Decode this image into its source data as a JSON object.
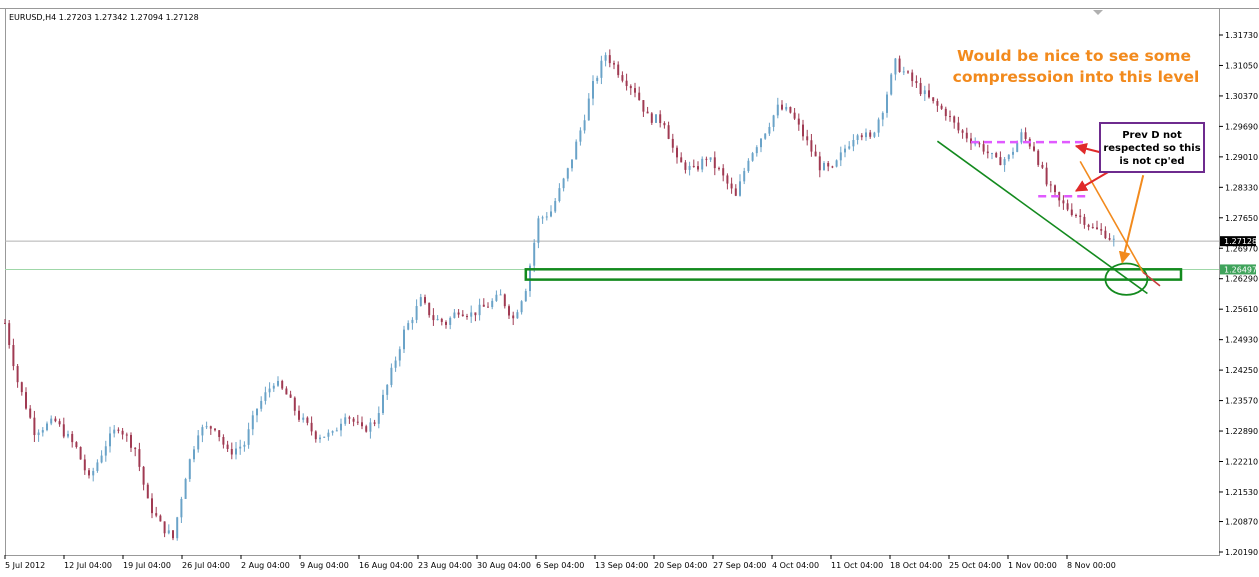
{
  "chart_data": {
    "type": "candlestick",
    "title": "EURUSD,H4  1.27203 1.27342 1.27094 1.27128",
    "symbol": "EURUSD",
    "timeframe": "H4",
    "ohlc_header": {
      "open": 1.27203,
      "high": 1.27342,
      "low": 1.27094,
      "close": 1.27128
    },
    "x_tick_labels": [
      "5 Jul 2012",
      "12 Jul 04:00",
      "19 Jul 04:00",
      "26 Jul 04:00",
      "2 Aug 04:00",
      "9 Aug 04:00",
      "16 Aug 04:00",
      "23 Aug 04:00",
      "30 Aug 04:00",
      "6 Sep 04:00",
      "13 Sep 04:00",
      "20 Sep 04:00",
      "27 Sep 04:00",
      "4 Oct 04:00",
      "11 Oct 04:00",
      "18 Oct 04:00",
      "25 Oct 04:00",
      "1 Nov 00:00",
      "8 Nov 00:00"
    ],
    "y_tick_labels": [
      "1.31730",
      "1.31050",
      "1.30370",
      "1.29690",
      "1.29010",
      "1.28330",
      "1.27650",
      "1.26970",
      "1.26290",
      "1.25610",
      "1.24930",
      "1.24250",
      "1.23570",
      "1.22890",
      "1.22210",
      "1.21530",
      "1.20870",
      "1.20190"
    ],
    "ylim": [
      1.2019,
      1.3173
    ],
    "bull_color": "#6aa3c8",
    "bear_color": "#a03a52",
    "price_path": [
      {
        "x": 0,
        "y": 1.253
      },
      {
        "x": 3,
        "y": 1.24
      },
      {
        "x": 7,
        "y": 1.229
      },
      {
        "x": 12,
        "y": 1.231
      },
      {
        "x": 17,
        "y": 1.225
      },
      {
        "x": 20,
        "y": 1.218
      },
      {
        "x": 24,
        "y": 1.226
      },
      {
        "x": 27,
        "y": 1.23
      },
      {
        "x": 31,
        "y": 1.225
      },
      {
        "x": 34,
        "y": 1.213
      },
      {
        "x": 37,
        "y": 1.208
      },
      {
        "x": 40,
        "y": 1.205
      },
      {
        "x": 43,
        "y": 1.219
      },
      {
        "x": 46,
        "y": 1.229
      },
      {
        "x": 50,
        "y": 1.23
      },
      {
        "x": 53,
        "y": 1.224
      },
      {
        "x": 57,
        "y": 1.226
      },
      {
        "x": 60,
        "y": 1.234
      },
      {
        "x": 64,
        "y": 1.24
      },
      {
        "x": 67,
        "y": 1.237
      },
      {
        "x": 70,
        "y": 1.232
      },
      {
        "x": 74,
        "y": 1.228
      },
      {
        "x": 78,
        "y": 1.228
      },
      {
        "x": 81,
        "y": 1.233
      },
      {
        "x": 85,
        "y": 1.229
      },
      {
        "x": 88,
        "y": 1.231
      },
      {
        "x": 91,
        "y": 1.239
      },
      {
        "x": 95,
        "y": 1.251
      },
      {
        "x": 99,
        "y": 1.258
      },
      {
        "x": 102,
        "y": 1.254
      },
      {
        "x": 105,
        "y": 1.253
      },
      {
        "x": 108,
        "y": 1.256
      },
      {
        "x": 111,
        "y": 1.255
      },
      {
        "x": 115,
        "y": 1.257
      },
      {
        "x": 118,
        "y": 1.259
      },
      {
        "x": 121,
        "y": 1.254
      },
      {
        "x": 124,
        "y": 1.261
      },
      {
        "x": 127,
        "y": 1.276
      },
      {
        "x": 130,
        "y": 1.278
      },
      {
        "x": 134,
        "y": 1.287
      },
      {
        "x": 137,
        "y": 1.296
      },
      {
        "x": 140,
        "y": 1.306
      },
      {
        "x": 143,
        "y": 1.313
      },
      {
        "x": 147,
        "y": 1.308
      },
      {
        "x": 150,
        "y": 1.305
      },
      {
        "x": 153,
        "y": 1.299
      },
      {
        "x": 157,
        "y": 1.298
      },
      {
        "x": 160,
        "y": 1.289
      },
      {
        "x": 164,
        "y": 1.287
      },
      {
        "x": 167,
        "y": 1.29
      },
      {
        "x": 170,
        "y": 1.287
      },
      {
        "x": 174,
        "y": 1.281
      },
      {
        "x": 177,
        "y": 1.29
      },
      {
        "x": 181,
        "y": 1.296
      },
      {
        "x": 184,
        "y": 1.301
      },
      {
        "x": 187,
        "y": 1.3
      },
      {
        "x": 190,
        "y": 1.295
      },
      {
        "x": 194,
        "y": 1.288
      },
      {
        "x": 197,
        "y": 1.287
      },
      {
        "x": 200,
        "y": 1.292
      },
      {
        "x": 203,
        "y": 1.296
      },
      {
        "x": 206,
        "y": 1.294
      },
      {
        "x": 209,
        "y": 1.301
      },
      {
        "x": 212,
        "y": 1.311
      },
      {
        "x": 215,
        "y": 1.308
      },
      {
        "x": 218,
        "y": 1.305
      },
      {
        "x": 221,
        "y": 1.302
      },
      {
        "x": 224,
        "y": 1.3
      },
      {
        "x": 227,
        "y": 1.296
      },
      {
        "x": 230,
        "y": 1.294
      },
      {
        "x": 233,
        "y": 1.292
      },
      {
        "x": 236,
        "y": 1.289
      },
      {
        "x": 239,
        "y": 1.29
      },
      {
        "x": 242,
        "y": 1.295
      },
      {
        "x": 245,
        "y": 1.292
      },
      {
        "x": 248,
        "y": 1.284
      },
      {
        "x": 251,
        "y": 1.28
      },
      {
        "x": 254,
        "y": 1.278
      },
      {
        "x": 257,
        "y": 1.276
      },
      {
        "x": 259,
        "y": 1.274
      },
      {
        "x": 262,
        "y": 1.273
      },
      {
        "x": 264,
        "y": 1.2713
      }
    ],
    "horizontal_lines": [
      {
        "price": 1.27128,
        "label": "1.27128",
        "color": "#b0b0b0",
        "tag_bg": "#000000",
        "tag_fg": "#ffffff"
      },
      {
        "price": 1.26497,
        "label": "1.26497",
        "color": "#9fd7a8",
        "tag_bg": "#3fa35b",
        "tag_fg": "#ffffff"
      }
    ],
    "annotations": [
      {
        "kind": "rectangle",
        "x": [
          124,
          280
        ],
        "y": [
          1.2627,
          1.265
        ],
        "color": "#138a1e"
      },
      {
        "kind": "trendline",
        "points": [
          [
            222,
            1.2936
          ],
          [
            272,
            1.2596
          ]
        ],
        "color": "#138a1e"
      },
      {
        "kind": "ellipse",
        "center": [
          267,
          1.2628
        ],
        "radius_x": 5.0,
        "radius_y": 0.0035,
        "color": "#138a1e"
      },
      {
        "kind": "trendline",
        "points": [
          [
            256,
            1.2891
          ],
          [
            271,
            1.2643
          ]
        ],
        "color": "#f28a1d"
      },
      {
        "kind": "line",
        "points": [
          [
            271,
            1.2643
          ],
          [
            275,
            1.2613
          ]
        ],
        "color": "#c83a3a"
      },
      {
        "kind": "dashed-level",
        "x": [
          230,
          257
        ],
        "y": 1.2934,
        "color": "#e05aff"
      },
      {
        "kind": "dashed-level",
        "x": [
          246,
          258
        ],
        "y": 1.2813,
        "color": "#e05aff"
      },
      {
        "kind": "arrow",
        "from": [
          263,
          1.2906
        ],
        "to": [
          255,
          1.2925
        ],
        "color": "#e02a2a"
      },
      {
        "kind": "arrow",
        "from": [
          265,
          1.288
        ],
        "to": [
          255,
          1.2825
        ],
        "color": "#e02a2a"
      },
      {
        "kind": "arrow",
        "from": [
          271,
          1.286
        ],
        "to": [
          266,
          1.2665
        ],
        "color": "#f28a1d"
      }
    ],
    "notes": [
      {
        "id": "orange_note",
        "lines": [
          "Would be nice to see some",
          "compressoion into this level"
        ],
        "color": "#f28a1d"
      },
      {
        "id": "box_note",
        "lines": [
          "Prev D not",
          "respected so this",
          "is not cp'ed"
        ],
        "border_color": "#6e2b8e"
      }
    ]
  }
}
